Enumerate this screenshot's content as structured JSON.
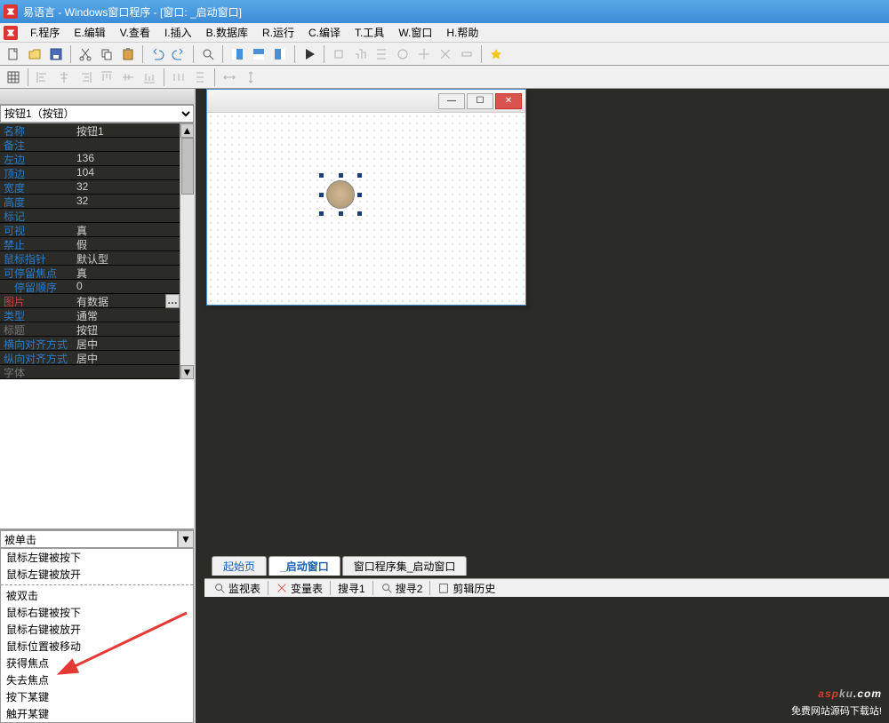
{
  "title": "易语言 - Windows窗口程序 - [窗口: _启动窗口]",
  "menu": [
    "F.程序",
    "E.编辑",
    "V.查看",
    "I.插入",
    "B.数据库",
    "R.运行",
    "C.编译",
    "T.工具",
    "W.窗口",
    "H.帮助"
  ],
  "dropdown": {
    "current": "按钮1（按钮）"
  },
  "props": [
    {
      "l": "名称",
      "v": "按钮1"
    },
    {
      "l": "备注",
      "v": ""
    },
    {
      "l": "左边",
      "v": "136"
    },
    {
      "l": "顶边",
      "v": "104"
    },
    {
      "l": "宽度",
      "v": "32"
    },
    {
      "l": "高度",
      "v": "32"
    },
    {
      "l": "标记",
      "v": ""
    },
    {
      "l": "可视",
      "v": "真"
    },
    {
      "l": "禁止",
      "v": "假"
    },
    {
      "l": "鼠标指针",
      "v": "默认型"
    },
    {
      "l": "可停留焦点",
      "v": "真"
    },
    {
      "l": "停留顺序",
      "v": "0",
      "indent": true
    },
    {
      "l": "图片",
      "v": "有数据",
      "sel": true,
      "more": true
    },
    {
      "l": "类型",
      "v": "通常"
    },
    {
      "l": "标题",
      "v": "按钮",
      "gray": true
    },
    {
      "l": "横向对齐方式",
      "v": "居中"
    },
    {
      "l": "纵向对齐方式",
      "v": "居中"
    },
    {
      "l": "字体",
      "v": "",
      "gray": true
    }
  ],
  "events": {
    "current": "被单击",
    "items": [
      "鼠标左键被按下",
      "鼠标左键被放开",
      "被双击",
      "鼠标右键被按下",
      "鼠标右键被放开",
      "鼠标位置被移动",
      "获得焦点",
      "失去焦点",
      "按下某键",
      "触开某键"
    ]
  },
  "tabs": [
    {
      "label": "起始页",
      "blue": true
    },
    {
      "label": "_启动窗口",
      "active": true
    },
    {
      "label": "窗口程序集_启动窗口"
    }
  ],
  "bottomTabs": [
    "监视表",
    "变量表",
    "搜寻1",
    "搜寻2",
    "剪辑历史"
  ],
  "logo": {
    "t1": "asp",
    "t2": "ku",
    "t3": ".com",
    "sub": "免费网站源码下载站!"
  }
}
